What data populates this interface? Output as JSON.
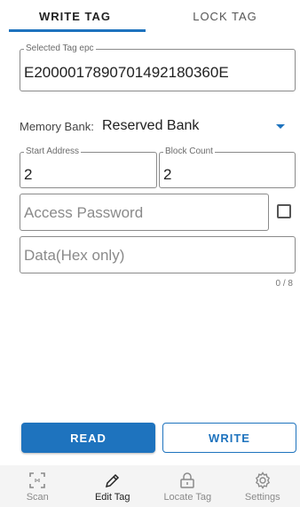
{
  "tabs": [
    {
      "label": "WRITE TAG",
      "active": true
    },
    {
      "label": "LOCK TAG",
      "active": false
    }
  ],
  "epc": {
    "label": "Selected Tag epc",
    "value": "E2000017890701492180360E"
  },
  "memory": {
    "label": "Memory Bank:",
    "value": "Reserved Bank"
  },
  "start_address": {
    "label": "Start Address",
    "value": "2"
  },
  "block_count": {
    "label": "Block Count",
    "value": "2"
  },
  "password": {
    "placeholder": "Access Password",
    "show_password_checked": false
  },
  "data": {
    "placeholder": "Data(Hex only)",
    "counter": "0 / 8"
  },
  "actions": {
    "read": "READ",
    "write": "WRITE"
  },
  "nav": [
    {
      "label": "Scan",
      "icon": "scan-icon",
      "active": false
    },
    {
      "label": "Edit Tag",
      "icon": "pencil-icon",
      "active": true
    },
    {
      "label": "Locate Tag",
      "icon": "lock-icon",
      "active": false
    },
    {
      "label": "Settings",
      "icon": "gear-icon",
      "active": false
    }
  ],
  "colors": {
    "accent": "#1e73be",
    "nav_background": "#f4f4f4"
  }
}
